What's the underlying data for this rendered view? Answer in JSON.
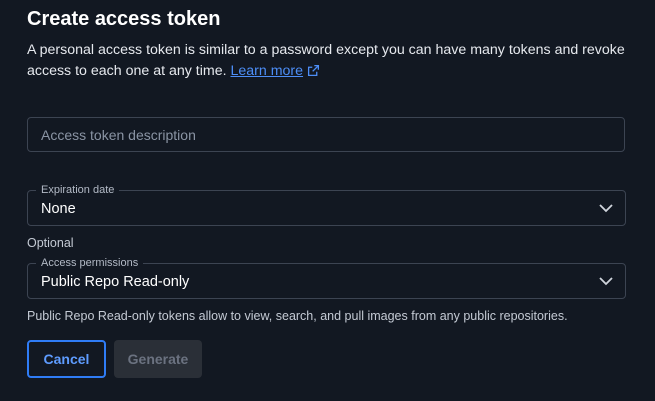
{
  "dialog": {
    "title": "Create access token",
    "description": "A personal access token is similar to a password except you can have many tokens and revoke access to each one at any time.",
    "learn_more": "Learn more"
  },
  "description_field": {
    "placeholder": "Access token description",
    "value": ""
  },
  "expiration": {
    "label": "Expiration date",
    "value": "None"
  },
  "optional_label": "Optional",
  "permissions": {
    "label": "Access permissions",
    "value": "Public Repo Read-only",
    "helper": "Public Repo Read-only tokens allow to view, search, and pull images from any public repositories."
  },
  "buttons": {
    "cancel": "Cancel",
    "generate": "Generate"
  },
  "icons": {
    "external": "external-link-icon",
    "chevron": "chevron-down-icon"
  },
  "colors": {
    "background": "#121822",
    "accent": "#2f7cf6",
    "link": "#4d8ef7",
    "disabled_button": "#2a2f37"
  }
}
